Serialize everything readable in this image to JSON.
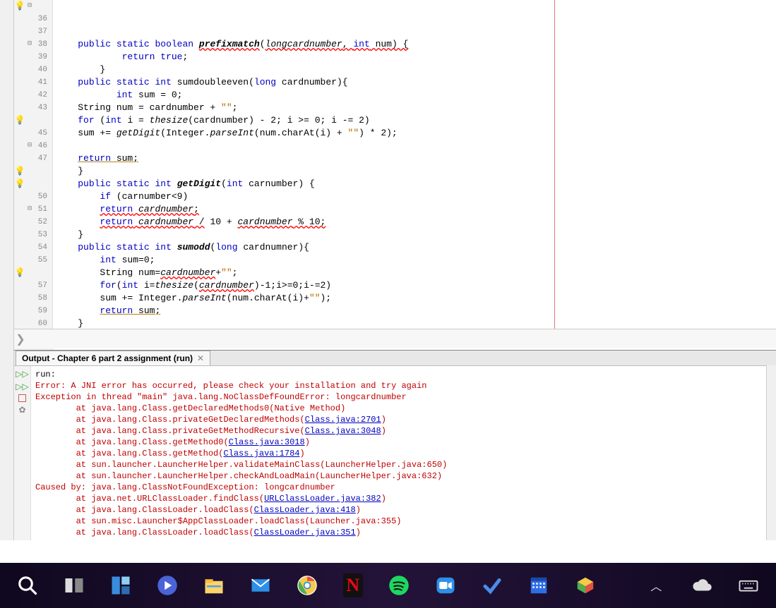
{
  "editor": {
    "margin_column": 80,
    "lines": [
      {
        "num": "",
        "glyph": "warn",
        "fold": "⊟",
        "html": "    <span class='kw'>public</span> <span class='kw'>static</span> <span class='kw'>boolean</span> <span class='bold ital err-wavy'>prefixmatch</span>(<span class='ital err-wavy'>longcardnumber</span><span class='err-wavy'>, </span><span class='kw err-wavy'>int</span><span class='err-wavy'> num) {</span>"
      },
      {
        "num": "36",
        "glyph": "",
        "fold": "",
        "html": "            <span class='kw'>return</span> <span class='kw'>true</span>;"
      },
      {
        "num": "37",
        "glyph": "",
        "fold": "",
        "html": "        }"
      },
      {
        "num": "38",
        "glyph": "",
        "fold": "⊟",
        "html": "    <span class='kw'>public</span> <span class='kw'>static</span> <span class='kw'>int</span> sumdoubleeven(<span class='kw'>long</span> cardnumber){"
      },
      {
        "num": "39",
        "glyph": "",
        "fold": "",
        "html": "           <span class='kw'>int</span> sum = 0;"
      },
      {
        "num": "40",
        "glyph": "",
        "fold": "",
        "html": "    String num = cardnumber + <span class='str'>\"\"</span>;"
      },
      {
        "num": "41",
        "glyph": "",
        "fold": "",
        "html": "    <span class='kw'>for</span> (<span class='kw'>int</span> i = <span class='ital'>thesize</span>(cardnumber) - 2; i &gt;= 0; i -= 2)"
      },
      {
        "num": "42",
        "glyph": "",
        "fold": "",
        "html": "    sum += <span class='ital'>getDigit</span>(Integer.<span class='ital'>parseInt</span>(num.charAt(i) + <span class='str'>\"\"</span>) * 2);"
      },
      {
        "num": "43",
        "glyph": "",
        "fold": "",
        "html": ""
      },
      {
        "num": "",
        "glyph": "warn",
        "fold": "",
        "html": "    <span class='kw warn-und'>return</span><span class='warn-und'> sum;</span>"
      },
      {
        "num": "45",
        "glyph": "",
        "fold": "",
        "html": "    }"
      },
      {
        "num": "46",
        "glyph": "",
        "fold": "⊟",
        "html": "    <span class='kw'>public</span> <span class='kw'>static</span> <span class='kw'>int</span> <span class='bold ital'>getDigit</span>(<span class='kw'>int</span> carnumber) {"
      },
      {
        "num": "47",
        "glyph": "",
        "fold": "",
        "html": "        <span class='kw'>if</span> (carnumber&lt;9)"
      },
      {
        "num": "",
        "glyph": "warn",
        "fold": "",
        "html": "        <span class='err-wavy'><span class='kw'>return</span> <span class='ital'>cardnumber</span>;</span>"
      },
      {
        "num": "",
        "glyph": "warn",
        "fold": "",
        "html": "        <span class='err-wavy'><span class='kw'>return</span> <span class='ital'>cardnumber</span> /</span> 10 + <span class='ital err-wavy'>cardnumber</span><span class='err-wavy'> % 10;</span>"
      },
      {
        "num": "50",
        "glyph": "",
        "fold": "",
        "html": "    }"
      },
      {
        "num": "51",
        "glyph": "",
        "fold": "⊟",
        "html": "    <span class='kw'>public</span> <span class='kw'>static</span> <span class='kw'>int</span> <span class='bold ital'>sumodd</span>(<span class='kw'>long</span> cardnumner){"
      },
      {
        "num": "52",
        "glyph": "",
        "fold": "",
        "html": "        <span class='kw'>int</span> sum=0;"
      },
      {
        "num": "53",
        "glyph": "",
        "fold": "",
        "html": "        String num=<span class='ital err-wavy'>cardnumber</span>+<span class='str'>\"\"</span>;"
      },
      {
        "num": "54",
        "glyph": "",
        "fold": "",
        "html": "        <span class='kw'>for</span>(<span class='kw'>int</span> i=<span class='ital'>thesize</span>(<span class='ital err-wavy'>cardnumber</span>)-1;i&gt;=0;i-=2)"
      },
      {
        "num": "55",
        "glyph": "",
        "fold": "",
        "html": "        sum += Integer.<span class='ital'>parseInt</span>(num.charAt(i)+<span class='str'>\"\"</span>);"
      },
      {
        "num": "",
        "glyph": "warn",
        "fold": "",
        "html": "        <span class='warn-und'><span class='kw'>return</span> sum;</span>"
      },
      {
        "num": "57",
        "glyph": "",
        "fold": "",
        "html": "    }"
      },
      {
        "num": "58",
        "glyph": "",
        "fold": "",
        "html": "}"
      },
      {
        "num": "59",
        "glyph": "",
        "fold": "",
        "html": ""
      },
      {
        "num": "60",
        "glyph": "",
        "fold": "",
        "html": ""
      }
    ]
  },
  "output": {
    "tab_title": "Output - Chapter 6 part 2 assignment (run)",
    "lines": [
      {
        "cls": "",
        "t": "run:"
      },
      {
        "cls": "errc",
        "t": "Error: A JNI error has occurred, please check your installation and try again"
      },
      {
        "cls": "errc",
        "t": "Exception in thread \"main\" java.lang.NoClassDefFoundError: longcardnumber"
      },
      {
        "cls": "errc",
        "t": "        at java.lang.Class.getDeclaredMethods0(Native Method)"
      },
      {
        "cls": "errc",
        "pre": "        at java.lang.Class.privateGetDeclaredMethods(",
        "link": "Class.java:2701",
        "post": ")"
      },
      {
        "cls": "errc",
        "pre": "        at java.lang.Class.privateGetMethodRecursive(",
        "link": "Class.java:3048",
        "post": ")"
      },
      {
        "cls": "errc",
        "pre": "        at java.lang.Class.getMethod0(",
        "link": "Class.java:3018",
        "post": ")"
      },
      {
        "cls": "errc",
        "pre": "        at java.lang.Class.getMethod(",
        "link": "Class.java:1784",
        "post": ")"
      },
      {
        "cls": "errc",
        "t": "        at sun.launcher.LauncherHelper.validateMainClass(LauncherHelper.java:650)"
      },
      {
        "cls": "errc",
        "t": "        at sun.launcher.LauncherHelper.checkAndLoadMain(LauncherHelper.java:632)"
      },
      {
        "cls": "errc",
        "t": "Caused by: java.lang.ClassNotFoundException: longcardnumber"
      },
      {
        "cls": "errc",
        "pre": "        at java.net.URLClassLoader.findClass(",
        "link": "URLClassLoader.java:382",
        "post": ")"
      },
      {
        "cls": "errc",
        "pre": "        at java.lang.ClassLoader.loadClass(",
        "link": "ClassLoader.java:418",
        "post": ")"
      },
      {
        "cls": "errc",
        "t": "        at sun.misc.Launcher$AppClassLoader.loadClass(Launcher.java:355)"
      },
      {
        "cls": "errc",
        "pre": "        at java.lang.ClassLoader.loadClass(",
        "link": "ClassLoader.java:351",
        "post": ")"
      }
    ]
  },
  "taskbar": {
    "items": [
      "search",
      "taskview",
      "widgets",
      "duo",
      "files",
      "mail",
      "chrome",
      "netflix",
      "spotify",
      "zoom",
      "todo",
      "calendar",
      "box"
    ],
    "tray": [
      "chevron",
      "cloud",
      "keyboard"
    ]
  }
}
